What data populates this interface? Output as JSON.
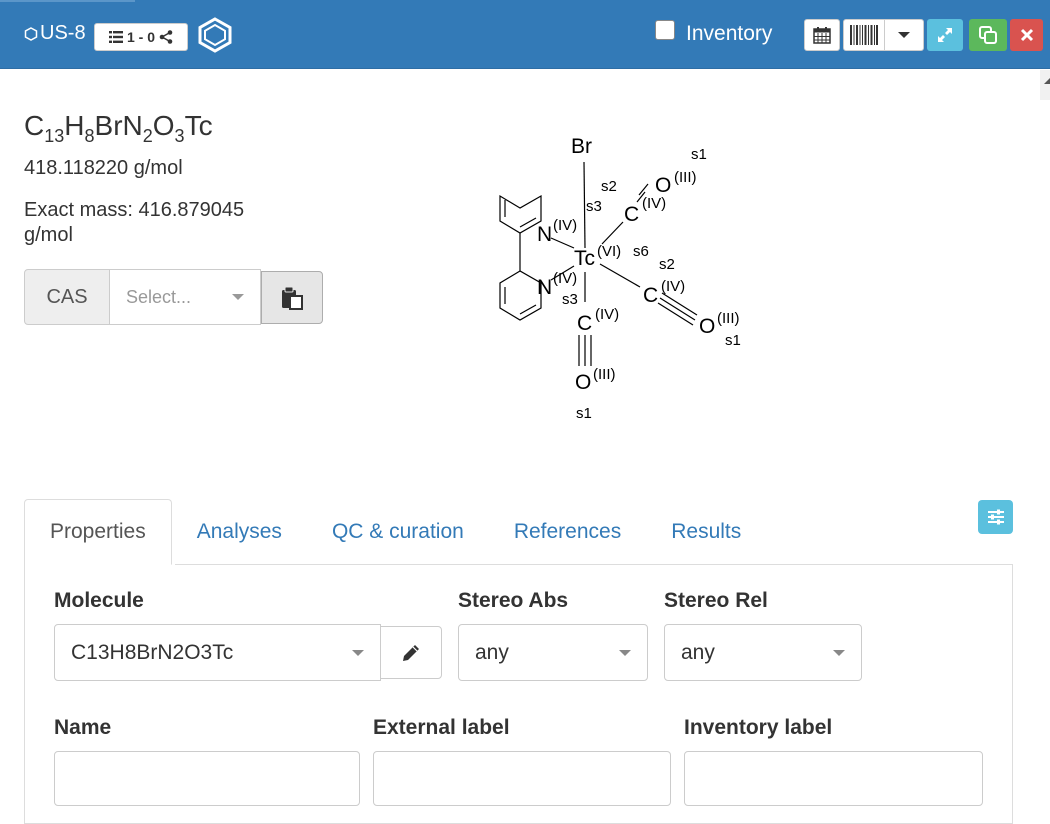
{
  "header": {
    "sample_id": "US-8",
    "badge_text": "1 - 0",
    "inventory_label": "Inventory",
    "colors": {
      "bar": "#337ab7",
      "info": "#5bc0de",
      "success": "#5cb85c",
      "danger": "#d9534f"
    }
  },
  "molecule": {
    "formula_parts": [
      "C",
      "13",
      "H",
      "8",
      "BrN",
      "2",
      "O",
      "3",
      "Tc"
    ],
    "molecular_weight": "418.118220 g/mol",
    "exact_mass": "Exact mass: 416.879045 g/mol"
  },
  "cas": {
    "label": "CAS",
    "placeholder": "Select..."
  },
  "structure": {
    "atoms": {
      "br": "Br",
      "tc": "Tc",
      "n1": "N",
      "n2": "N",
      "c1": "C",
      "c2": "C",
      "c3": "C",
      "o1": "O",
      "o2": "O",
      "o3": "O"
    },
    "annotations": {
      "n1_ox": "(IV)",
      "n2_ox": "(IV)",
      "tc_ox": "(VI)",
      "tc_s": "s6",
      "c1_ox": "(IV)",
      "c2_ox": "(IV)",
      "c3_ox": "(IV)",
      "o1_ox": "(III)",
      "o2_ox": "(III)",
      "o3_ox": "(III)",
      "s1_a": "s1",
      "s1_b": "s1",
      "s1_c": "s1",
      "s2_a": "s2",
      "s2_b": "s2",
      "s3_a": "s3",
      "s3_b": "s3"
    }
  },
  "tabs": [
    {
      "label": "Properties",
      "active": true
    },
    {
      "label": "Analyses",
      "active": false
    },
    {
      "label": "QC & curation",
      "active": false
    },
    {
      "label": "References",
      "active": false
    },
    {
      "label": "Results",
      "active": false
    }
  ],
  "properties": {
    "molecule_label": "Molecule",
    "molecule_value": "C13H8BrN2O3Tc",
    "stereo_abs_label": "Stereo Abs",
    "stereo_abs_value": "any",
    "stereo_rel_label": "Stereo Rel",
    "stereo_rel_value": "any",
    "name_label": "Name",
    "external_label": "External label",
    "inventory_label": "Inventory label"
  }
}
